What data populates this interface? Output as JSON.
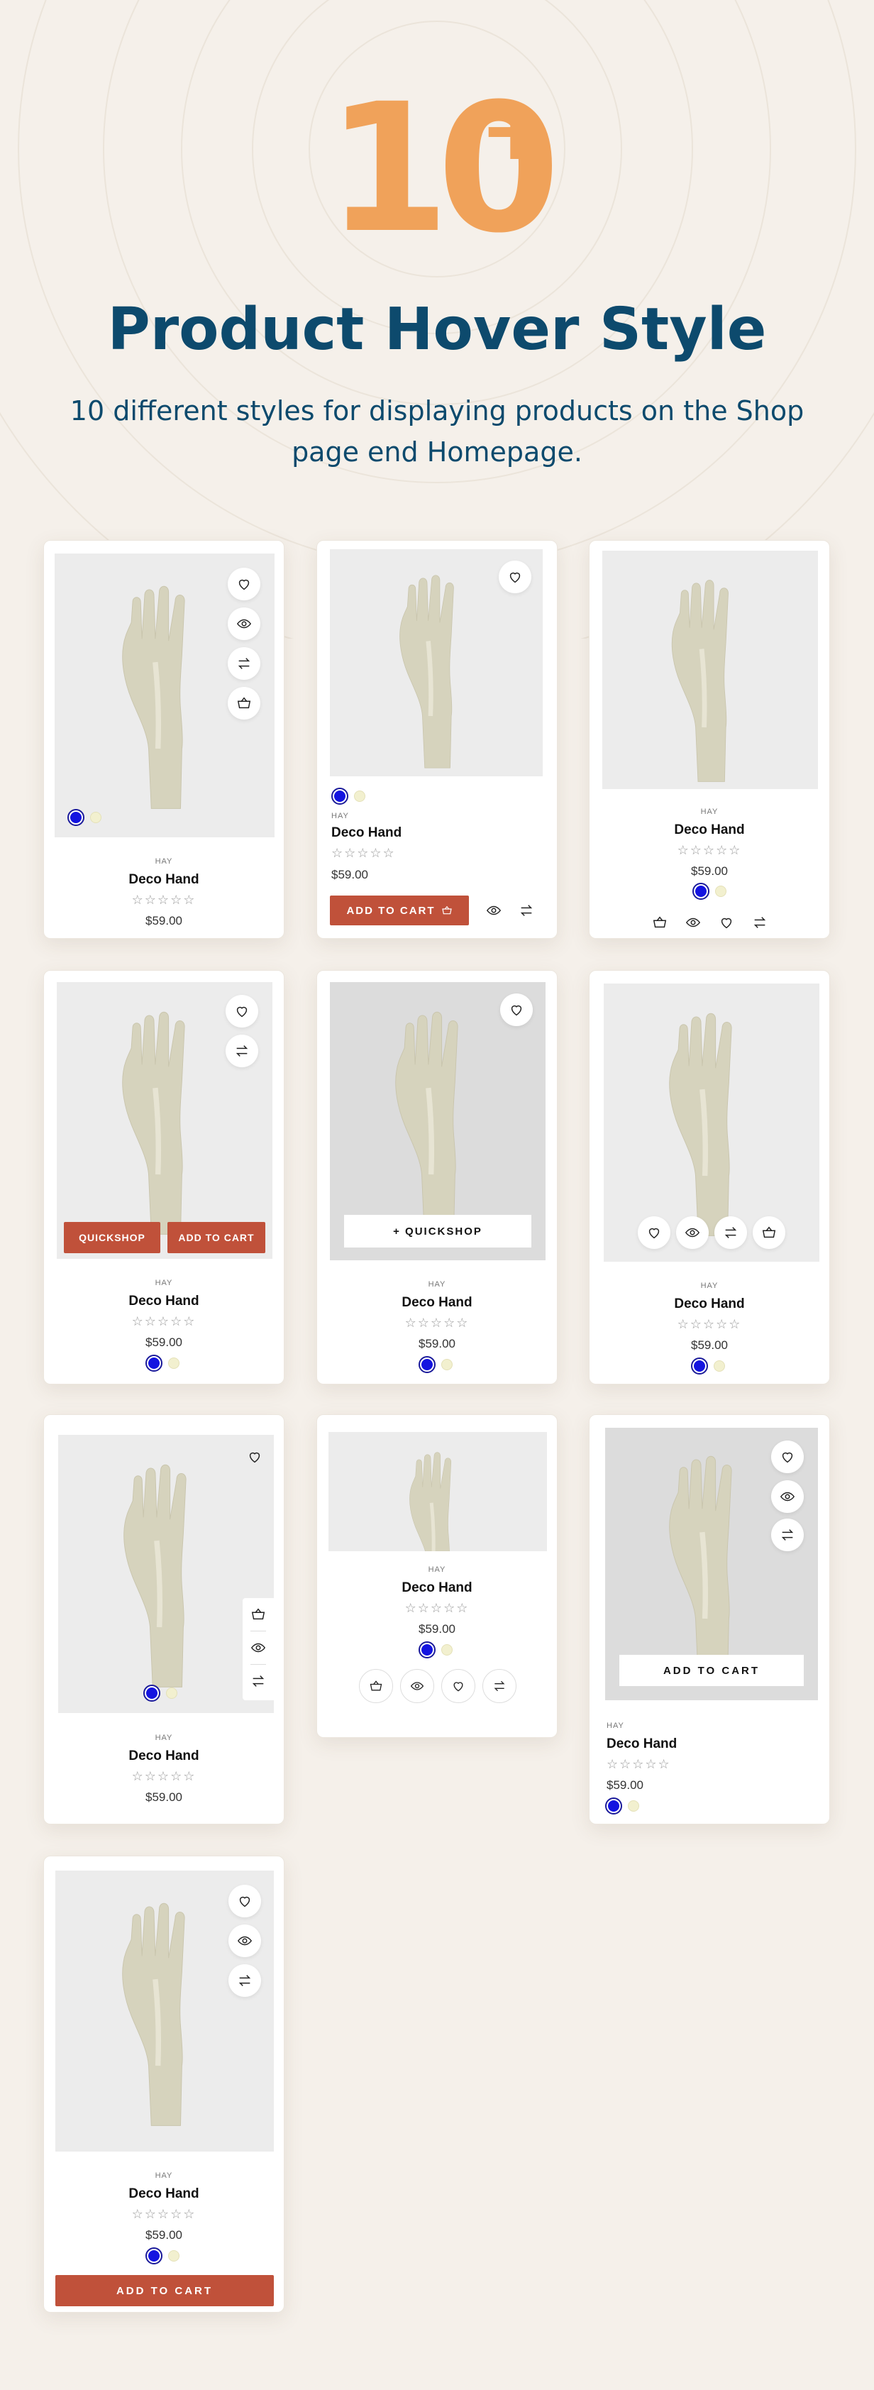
{
  "hero": {
    "number": "10",
    "plus": "+",
    "title": "Product Hover Style",
    "subtitle": "10 different styles for displaying products on the Shop page end Homepage."
  },
  "colors": {
    "background": "#f5f0ea",
    "accent_orange": "#f0a25a",
    "title_blue": "#0d4a6d",
    "button_red": "#c0513a",
    "swatch_blue": "#1414e0",
    "swatch_cream": "#f2f0cf"
  },
  "product": {
    "brand": "HAY",
    "name": "Deco Hand",
    "stars": "☆☆☆☆☆",
    "price": "$59.00"
  },
  "labels": {
    "add_to_cart_icon": "ADD TO CART",
    "quickshop": "QUICKSHOP",
    "add_to_cart": "ADD TO CART",
    "plus_quickshop": "+ QUICKSHOP",
    "add_to_cart_spaced": "ADD TO CART"
  },
  "icons": [
    "heart-icon",
    "eye-icon",
    "compare-icon",
    "basket-icon"
  ]
}
